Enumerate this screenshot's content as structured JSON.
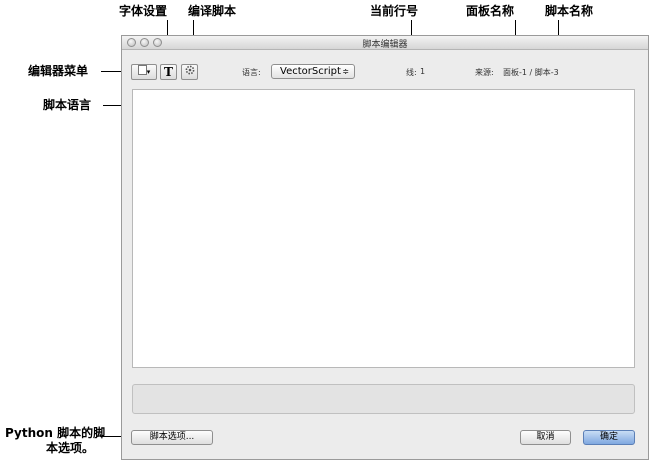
{
  "callouts": {
    "font_settings": "字体设置",
    "compile_script": "编译脚本",
    "current_line": "当前行号",
    "panel_name": "面板名称",
    "script_name": "脚本名称",
    "editor_menu": "编辑器菜单",
    "script_language": "脚本语言",
    "python_options_line1": "Python 脚本的脚",
    "python_options_line2": "本选项。"
  },
  "window": {
    "title": "脚本编辑器"
  },
  "toolbar": {
    "font_button_glyph": "T",
    "language_label": "语言:",
    "language_value": "VectorScript",
    "line_label": "线:",
    "line_value": "1",
    "source_label": "来源:",
    "source_value": "面板-1 / 脚本-3"
  },
  "footer": {
    "script_options_button": "脚本选项...",
    "cancel_button": "取消",
    "ok_button": "确定"
  }
}
